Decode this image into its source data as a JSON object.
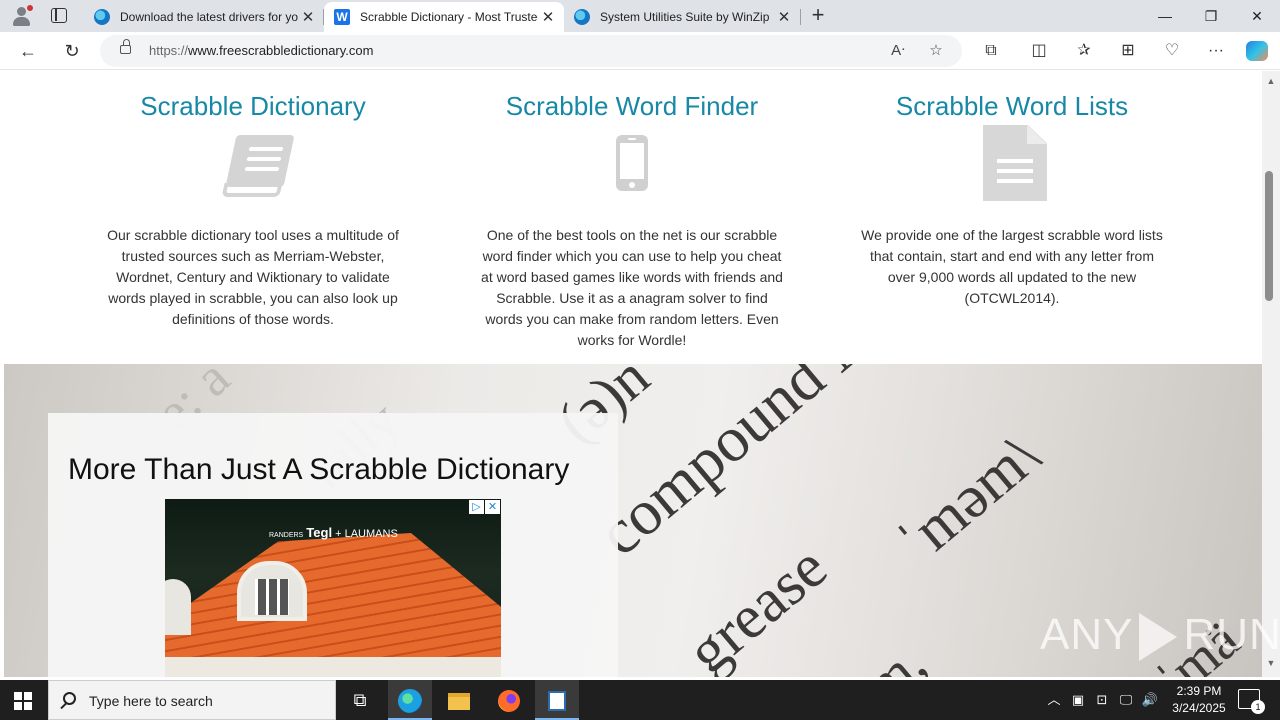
{
  "browser": {
    "tabs": [
      {
        "title": "Download the latest drivers for your"
      },
      {
        "title": "Scrabble Dictionary - Most Trusted"
      },
      {
        "title": "System Utilities Suite by WinZip"
      }
    ],
    "url_prefix": "https://",
    "url_host": "www.freescrabbledictionary.com",
    "active_tab_favicon": "W"
  },
  "page": {
    "columns": [
      {
        "heading": "Scrabble Dictionary",
        "icon": "book-icon",
        "text": "Our scrabble dictionary tool uses a multitude of trusted sources such as Merriam-Webster, Wordnet, Century and Wiktionary to validate words played in scrabble, you can also look up definitions of those words."
      },
      {
        "heading": "Scrabble Word Finder",
        "icon": "mobile-phone-icon",
        "text": "One of the best tools on the net is our scrabble word finder which you can use to help you cheat at word based games like words with friends and Scrabble. Use it as a anagram solver to find words you can make from random letters. Even works for Wordle!"
      },
      {
        "heading": "Scrabble Word Lists",
        "icon": "document-icon",
        "text": "We provide one of the largest scrabble word lists that contain, start and end with any letter from over 9,000 words all updated to the new (OTCWL2014)."
      }
    ],
    "hero": {
      "title": "More Than Just A Scrabble Dictionary",
      "bg_words": [
        "compound N",
        "grease",
        "ˈməm\\",
        "(ə)n",
        "ˈmä",
        "ām,",
        "e: a",
        "rally"
      ],
      "ad": {
        "brand_small": "RANDERS",
        "brand_main": "Tegl",
        "brand_partner": "+ LAUMANS",
        "adchoice_play": "▷",
        "adchoice_close": "✕"
      }
    },
    "watermark": {
      "left": "ANY",
      "right": "RUN"
    }
  },
  "taskbar": {
    "search_placeholder": "Type here to search",
    "time": "2:39 PM",
    "date": "3/24/2025",
    "notification_count": "1"
  },
  "colors": {
    "heading": "#1788a6",
    "icon_gray": "#d4d4d4",
    "taskbar": "#1f1f1f"
  }
}
